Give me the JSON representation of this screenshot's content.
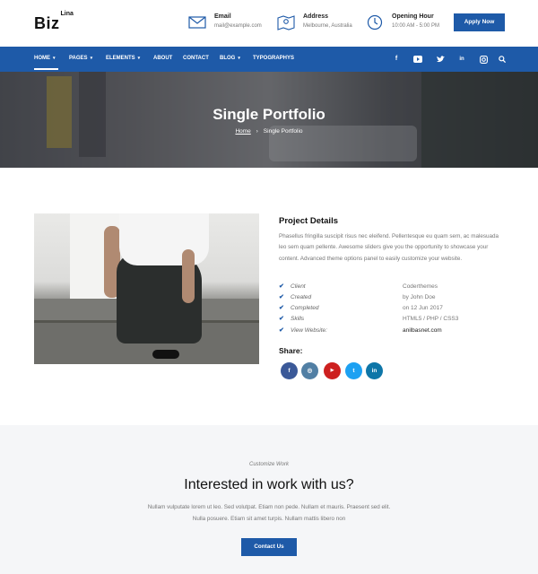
{
  "header": {
    "logo": "Biz",
    "logo_sup": "Lina",
    "email": {
      "title": "Email",
      "value": "mail@example.com",
      "icon": "envelope-icon"
    },
    "address": {
      "title": "Address",
      "value": "Melbourne, Australia",
      "icon": "map-icon"
    },
    "opening": {
      "title": "Opening Hour",
      "value": "10:00 AM - 5:00 PM",
      "icon": "clock-icon"
    },
    "apply_label": "Apply Now"
  },
  "nav": {
    "items": [
      {
        "label": "HOME",
        "caret": "▾"
      },
      {
        "label": "PAGES",
        "caret": "▾"
      },
      {
        "label": "ELEMENTS",
        "caret": "▾"
      },
      {
        "label": "ABOUT",
        "caret": ""
      },
      {
        "label": "CONTACT",
        "caret": ""
      },
      {
        "label": "BLOG",
        "caret": "▾"
      },
      {
        "label": "TYPOGRAPHYS",
        "caret": ""
      }
    ],
    "social": [
      "facebook-icon",
      "youtube-icon",
      "twitter-icon",
      "linkedin-icon",
      "instagram-icon",
      "search-icon"
    ]
  },
  "hero": {
    "title": "Single Portfolio",
    "breadcrumb_home": "Home",
    "breadcrumb_sep": "›",
    "breadcrumb_current": "Single Portfolio"
  },
  "project": {
    "title": "Project Details",
    "text": "Phasellus fringilla suscipit risus nec eleifend. Pellentesque eu quam sem, ac malesuada leo sem quam pellente. Awesome sliders give you the opportunity to showcase your content. Advanced theme options panel to easily customize your website.",
    "details": [
      {
        "label": "Client",
        "value": "Coderthemes"
      },
      {
        "label": "Created",
        "value": "by John Doe"
      },
      {
        "label": "Completed",
        "value": "on 12 Jun 2017"
      },
      {
        "label": "Skills",
        "value": "HTML5 / PHP / CSS3"
      },
      {
        "label": "View Website:",
        "value": "anilbasnet.com"
      }
    ],
    "share_label": "Share:",
    "share": [
      {
        "icon": "facebook-icon",
        "glyph": "f",
        "color": "#3b5998"
      },
      {
        "icon": "instagram-icon",
        "glyph": "◎",
        "color": "#517fa4"
      },
      {
        "icon": "youtube-icon",
        "glyph": "▶",
        "color": "#cd201f"
      },
      {
        "icon": "twitter-icon",
        "glyph": "t",
        "color": "#1da1f2"
      },
      {
        "icon": "linkedin-icon",
        "glyph": "in",
        "color": "#0e76a8"
      }
    ]
  },
  "cta": {
    "subtitle": "Customize Work",
    "title": "Interested in work with us?",
    "text_line1": "Nullam vulputate lorem ut leo. Sed volutpat. Etiam non pede. Nullam et mauris. Praesent sed elit.",
    "text_line2": "Nulla posuere. Etiam sit amet turpis. Nullam mattis libero non",
    "button_label": "Contact Us"
  },
  "colors": {
    "accent": "#1e5aa8"
  }
}
